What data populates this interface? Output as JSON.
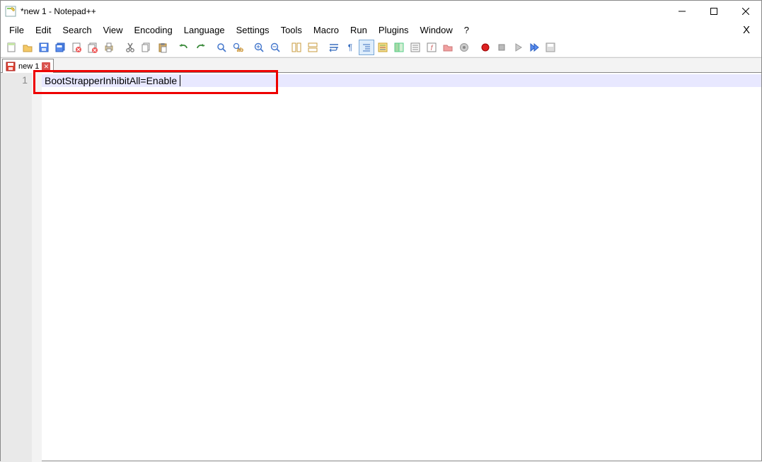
{
  "window": {
    "title": "*new 1 - Notepad++"
  },
  "menu": {
    "items": [
      "File",
      "Edit",
      "Search",
      "View",
      "Encoding",
      "Language",
      "Settings",
      "Tools",
      "Macro",
      "Run",
      "Plugins",
      "Window",
      "?"
    ],
    "xlabel": "X"
  },
  "tab": {
    "label": "new 1"
  },
  "editor": {
    "line_number": "1",
    "line_text": "BootStrapperInhibitAll=Enable"
  }
}
